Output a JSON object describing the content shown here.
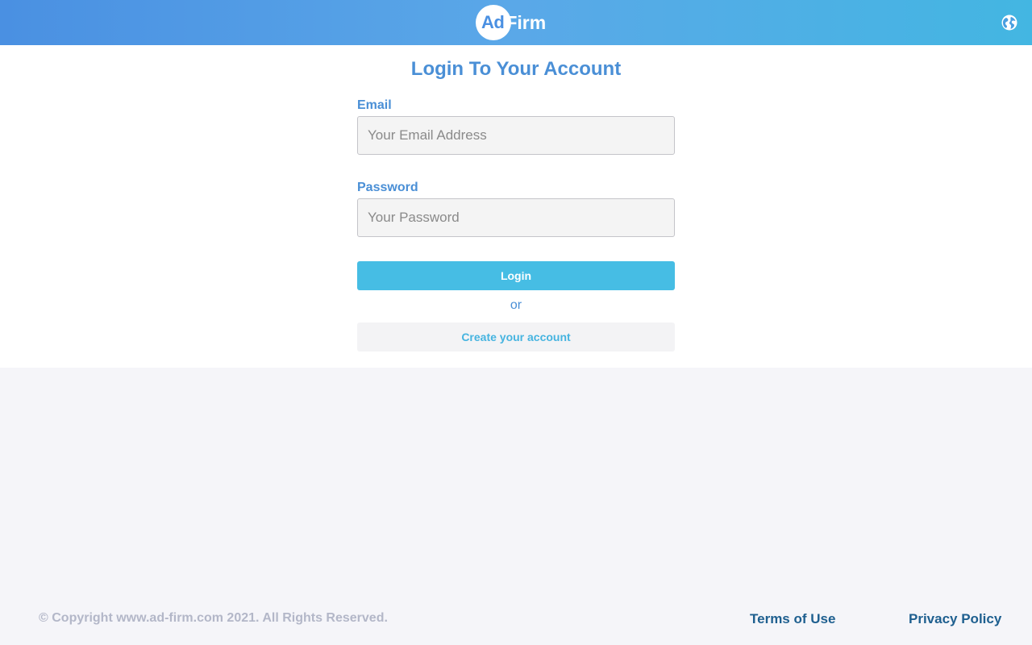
{
  "header": {
    "logo_ad": "Ad",
    "logo_firm": "Firm",
    "language_icon": "globe-icon"
  },
  "login": {
    "title": "Login To Your Account",
    "email_label": "Email",
    "email_placeholder": "Your Email Address",
    "email_value": "",
    "password_label": "Password",
    "password_placeholder": "Your Password",
    "password_value": "",
    "login_button": "Login",
    "or_text": "or",
    "create_account_button": "Create your account"
  },
  "footer": {
    "copyright": "© Copyright www.ad-firm.com 2021. All Rights Reserved.",
    "terms_link": "Terms of Use",
    "privacy_link": "Privacy Policy"
  },
  "colors": {
    "header_gradient_start": "#4a90e2",
    "header_gradient_end": "#43b6e2",
    "accent_blue": "#4a8fd6",
    "login_button": "#46bde4",
    "footer_link": "#1e5f8f",
    "page_background": "#f5f5f9"
  }
}
